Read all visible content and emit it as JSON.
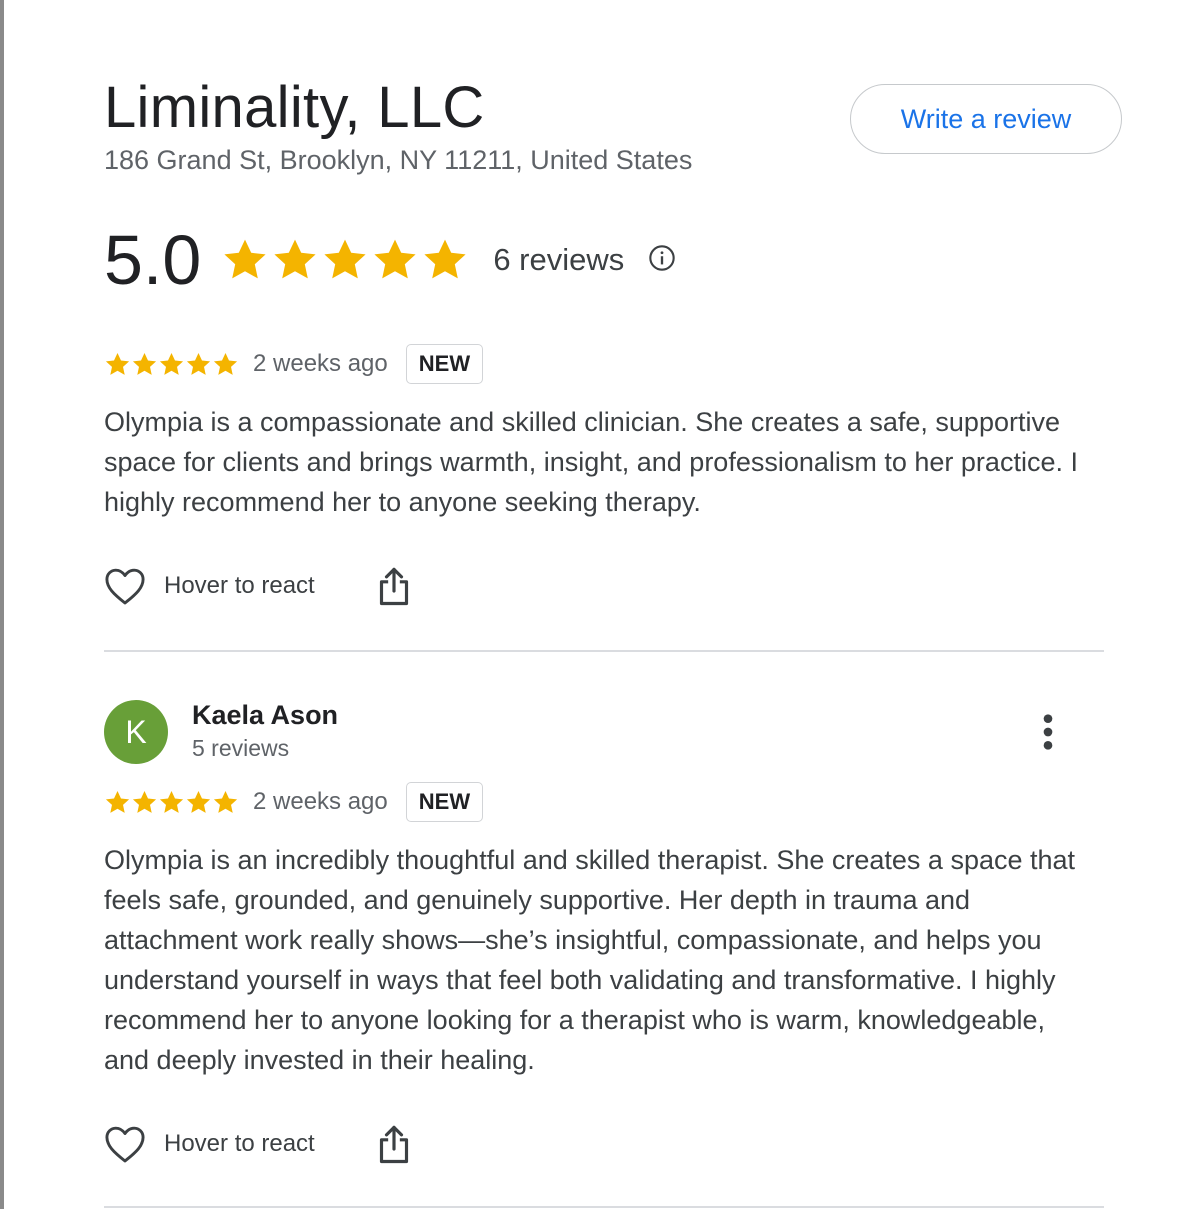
{
  "business": {
    "name": "Liminality, LLC",
    "address": "186 Grand St, Brooklyn, NY 11211, United States",
    "write_review_label": "Write a review"
  },
  "rating": {
    "score": "5.0",
    "stars": 5,
    "review_count": "6 reviews",
    "info_icon": "info-icon"
  },
  "colors": {
    "star": "#f4b400",
    "link": "#1a73e8",
    "avatar": "#689f38"
  },
  "reviews": [
    {
      "stars": 5,
      "time": "2 weeks ago",
      "badge": "NEW",
      "text": "Olympia is a compassionate and skilled clinician. She creates a safe, supportive space for clients and brings warmth, insight, and professionalism to her practice. I highly recommend her to anyone seeking therapy.",
      "react_label": "Hover to react"
    },
    {
      "author_initial": "K",
      "author_name": "Kaela Ason",
      "author_reviews": "5 reviews",
      "stars": 5,
      "time": "2 weeks ago",
      "badge": "NEW",
      "text": "Olympia is an incredibly thoughtful and skilled therapist. She creates a space that feels safe, grounded, and genuinely supportive. Her depth in trauma and attachment work really shows—she’s insightful, compassionate, and helps you understand yourself in ways that feel both validating and transformative. I highly recommend her to anyone looking for a therapist who is warm, knowledgeable, and deeply invested in their healing.",
      "react_label": "Hover to react"
    }
  ]
}
